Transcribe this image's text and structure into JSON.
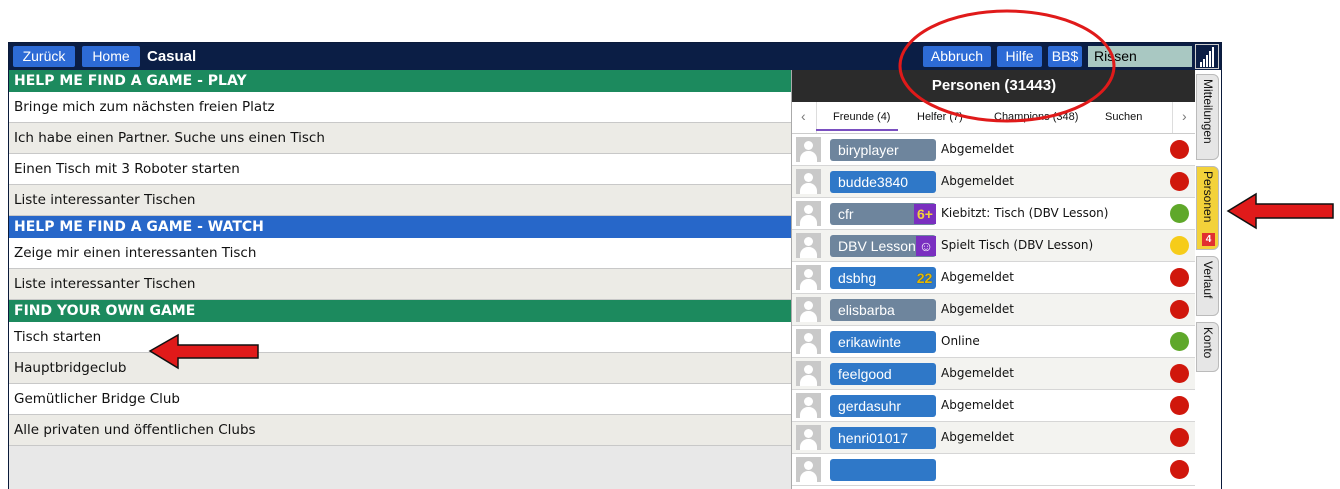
{
  "topbar": {
    "back": "Zurück",
    "home": "Home",
    "title": "Casual",
    "cancel": "Abbruch",
    "help": "Hilfe",
    "bbs": "BB$",
    "status": "Rissen"
  },
  "menu": {
    "play_header": "HELP ME FIND A GAME - PLAY",
    "play_items": [
      "Bringe mich zum nächsten freien Platz",
      "Ich habe einen Partner. Suche uns einen Tisch",
      "Einen Tisch mit 3 Roboter starten",
      "Liste interessanter Tischen"
    ],
    "watch_header": "HELP ME FIND A GAME - WATCH",
    "watch_items": [
      "Zeige mir einen interessanten Tisch",
      "Liste interessanter Tischen"
    ],
    "own_header": "FIND YOUR OWN GAME",
    "own_items": [
      "Tisch starten",
      "Hauptbridgeclub",
      "Gemütlicher Bridge Club",
      "Alle privaten und öffentlichen Clubs"
    ]
  },
  "people": {
    "title": "Personen (31443)",
    "tabs": [
      "Freunde (4)",
      "Helfer (7)",
      "Champions (348)",
      "Suchen"
    ],
    "list": [
      {
        "name": "biryplayer",
        "status": "Abgemeldet",
        "dot": "#d0170c"
      },
      {
        "name": "budde3840",
        "status": "Abgemeldet",
        "dot": "#d0170c"
      },
      {
        "name": "cfr",
        "status": "Kiebitzt: Tisch (DBV Lesson)",
        "dot": "#5fa82a",
        "badge": "6+"
      },
      {
        "name": "DBV Lesson",
        "status": "Spielt Tisch (DBV Lesson)",
        "dot": "#f6cc1a"
      },
      {
        "name": "dsbhg",
        "status": "Abgemeldet",
        "dot": "#d0170c",
        "badge": "22"
      },
      {
        "name": "elisbarba",
        "status": "Abgemeldet",
        "dot": "#d0170c"
      },
      {
        "name": "erikawinte",
        "status": "Online",
        "dot": "#5fa82a"
      },
      {
        "name": "feelgood",
        "status": "Abgemeldet",
        "dot": "#d0170c"
      },
      {
        "name": "gerdasuhr",
        "status": "Abgemeldet",
        "dot": "#d0170c"
      },
      {
        "name": "henri01017",
        "status": "Abgemeldet",
        "dot": "#d0170c"
      }
    ]
  },
  "sidetabs": {
    "messages": "Mitteilungen",
    "people": "Personen",
    "people_count": "4",
    "history": "Verlauf",
    "account": "Konto"
  }
}
